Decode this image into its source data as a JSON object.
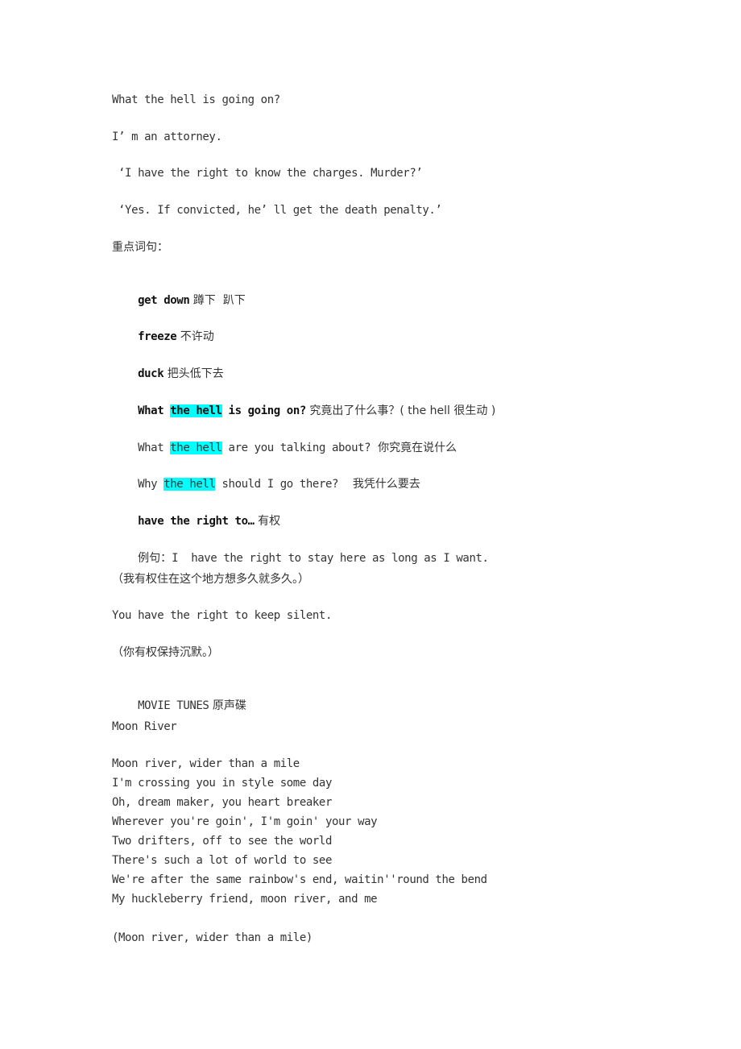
{
  "dialogue": [
    "What the hell is going on?",
    "I’ m an attorney.",
    " ‘I have the right to know the charges. Murder?’",
    " ‘Yes. If convicted, he’ ll get the death penalty.’"
  ],
  "section_heading": "重点词句：",
  "vocab": [
    {
      "term": "get down",
      "meaning": " 蹲下  趴下"
    },
    {
      "term": "freeze",
      "meaning": " 不许动"
    },
    {
      "term": "duck",
      "meaning": " 把头低下去"
    }
  ],
  "phrase_examples": [
    {
      "pre": "What ",
      "highlight": "the hell",
      "post": " is going on?",
      "translation": " 究竟出了什么事？( the hell 很生动 )"
    },
    {
      "pre": "What ",
      "highlight": "the hell",
      "post": " are you talking about?",
      "translation": "  你究竟在说什么"
    },
    {
      "pre": "Why ",
      "highlight": "the hell",
      "post": " should I go there?",
      "translation": "    我凭什么要去"
    }
  ],
  "have_right": {
    "term": "have the right to…",
    "meaning": " 有权",
    "example_label": "例句：",
    "example": "I  have the right to stay here as long as I want.",
    "example_translation": "（我有权住在这个地方想多久就多久。）",
    "example2": "You have the right to keep silent.",
    "example2_translation": "（你有权保持沉默。）"
  },
  "movie_tunes": {
    "heading_en": "MOVIE TUNES",
    "heading_cn": " 原声碟",
    "song_title": "Moon River",
    "lyrics": [
      "Moon river, wider than a mile",
      "I'm crossing you in style some day",
      "Oh, dream maker, you heart breaker",
      "Wherever you're goin', I'm goin' your way",
      "Two drifters, off to see the world",
      "There's such a lot of world to see",
      "We're after the same rainbow's end, waitin''round the bend",
      "My huckleberry friend, moon river, and me"
    ],
    "last_line": "(Moon river, wider than a mile)"
  },
  "colors": {
    "highlight": "#00ffff",
    "text": "#333333"
  }
}
